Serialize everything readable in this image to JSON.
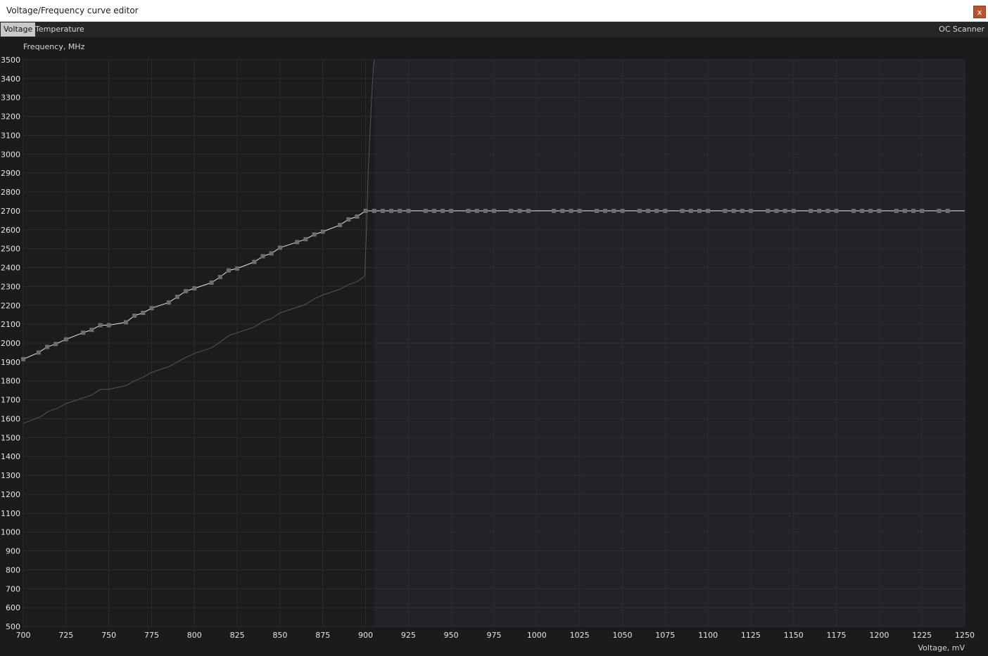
{
  "window": {
    "title": "Voltage/Frequency curve editor",
    "close_label": "x"
  },
  "tabs": [
    {
      "label": "Voltage",
      "active": true
    },
    {
      "label": "Temperature",
      "active": false
    }
  ],
  "oc_scanner_label": "OC Scanner",
  "colors": {
    "background": "#1b1b1d",
    "disabled_region": "#222228",
    "curve": "#e8e8e8",
    "reference_curve": "#55555a",
    "point": "#6e6e72",
    "grid": "#2c2c30",
    "close_button": "#b5552e"
  },
  "chart_data": {
    "type": "line",
    "ylabel": "Frequency, MHz",
    "xlabel": "Voltage, mV",
    "xlim": [
      700,
      1250
    ],
    "ylim": [
      500,
      3500
    ],
    "x_ticks": [
      700,
      725,
      750,
      775,
      800,
      825,
      850,
      875,
      900,
      925,
      950,
      975,
      1000,
      1025,
      1050,
      1075,
      1100,
      1125,
      1150,
      1175,
      1200,
      1225,
      1250
    ],
    "y_ticks": [
      500,
      600,
      700,
      800,
      900,
      1000,
      1100,
      1200,
      1300,
      1400,
      1500,
      1600,
      1700,
      1800,
      1900,
      2000,
      2100,
      2200,
      2300,
      2400,
      2500,
      2600,
      2700,
      2800,
      2900,
      3000,
      3100,
      3200,
      3300,
      3400,
      3500
    ],
    "grid": true,
    "disabled_region_start": 905,
    "series": [
      {
        "role": "curve",
        "x": [
          700,
          709,
          714,
          719,
          725,
          735,
          740,
          745,
          750,
          760,
          765,
          770,
          775,
          785,
          790,
          795,
          800,
          810,
          815,
          820,
          825,
          835,
          840,
          845,
          850,
          860,
          865,
          870,
          875,
          885,
          890,
          895,
          900,
          905,
          910,
          915,
          920,
          925,
          935,
          940,
          945,
          950,
          960,
          965,
          970,
          975,
          985,
          990,
          995,
          1010,
          1015,
          1020,
          1025,
          1035,
          1040,
          1045,
          1050,
          1060,
          1065,
          1070,
          1075,
          1085,
          1090,
          1095,
          1100,
          1110,
          1115,
          1120,
          1125,
          1135,
          1140,
          1145,
          1150,
          1160,
          1165,
          1170,
          1175,
          1185,
          1190,
          1195,
          1200,
          1210,
          1215,
          1220,
          1225,
          1235,
          1240,
          1250
        ],
        "y": [
          1915,
          1950,
          1980,
          1995,
          2020,
          2055,
          2070,
          2095,
          2095,
          2110,
          2145,
          2160,
          2185,
          2215,
          2245,
          2275,
          2290,
          2320,
          2350,
          2385,
          2395,
          2430,
          2460,
          2475,
          2505,
          2535,
          2550,
          2575,
          2590,
          2625,
          2655,
          2670,
          2700,
          2700,
          2700,
          2700,
          2700,
          2700,
          2700,
          2700,
          2700,
          2700,
          2700,
          2700,
          2700,
          2700,
          2700,
          2700,
          2700,
          2700,
          2700,
          2700,
          2700,
          2700,
          2700,
          2700,
          2700,
          2700,
          2700,
          2700,
          2700,
          2700,
          2700,
          2700,
          2700,
          2700,
          2700,
          2700,
          2700,
          2700,
          2700,
          2700,
          2700,
          2700,
          2700,
          2700,
          2700,
          2700,
          2700,
          2700,
          2700,
          2700,
          2700,
          2700,
          2700,
          2700,
          2700,
          2700
        ],
        "points": [
          700,
          709,
          714,
          719,
          725,
          735,
          740,
          745,
          750,
          760,
          765,
          770,
          775,
          785,
          790,
          795,
          800,
          810,
          815,
          820,
          825,
          835,
          840,
          845,
          850,
          860,
          865,
          870,
          875,
          885,
          890,
          895,
          900,
          905,
          910,
          915,
          920,
          925,
          935,
          940,
          945,
          950,
          960,
          965,
          970,
          975,
          985,
          990,
          995,
          1010,
          1015,
          1020,
          1025,
          1035,
          1040,
          1045,
          1050,
          1060,
          1065,
          1070,
          1075,
          1085,
          1090,
          1095,
          1100,
          1110,
          1115,
          1120,
          1125,
          1135,
          1140,
          1145,
          1150,
          1160,
          1165,
          1170,
          1175,
          1185,
          1190,
          1195,
          1200,
          1210,
          1215,
          1220,
          1225,
          1235,
          1240
        ]
      },
      {
        "role": "reference",
        "x": [
          700,
          710,
          715,
          720,
          725,
          730,
          740,
          745,
          750,
          755,
          760,
          765,
          770,
          775,
          780,
          785,
          790,
          795,
          800,
          805,
          810,
          815,
          820,
          825,
          830,
          835,
          840,
          845,
          850,
          855,
          860,
          865,
          870,
          875,
          880,
          885,
          890,
          895,
          899.5,
          900.5,
          901.5,
          902.5,
          903.5,
          904.5,
          905
        ],
        "y": [
          1575,
          1610,
          1640,
          1655,
          1680,
          1695,
          1725,
          1755,
          1755,
          1765,
          1775,
          1800,
          1820,
          1845,
          1860,
          1875,
          1900,
          1925,
          1945,
          1960,
          1975,
          2005,
          2040,
          2055,
          2070,
          2085,
          2115,
          2130,
          2160,
          2175,
          2190,
          2205,
          2235,
          2255,
          2270,
          2285,
          2310,
          2325,
          2355,
          2600,
          2900,
          3100,
          3300,
          3450,
          3500
        ]
      }
    ]
  }
}
